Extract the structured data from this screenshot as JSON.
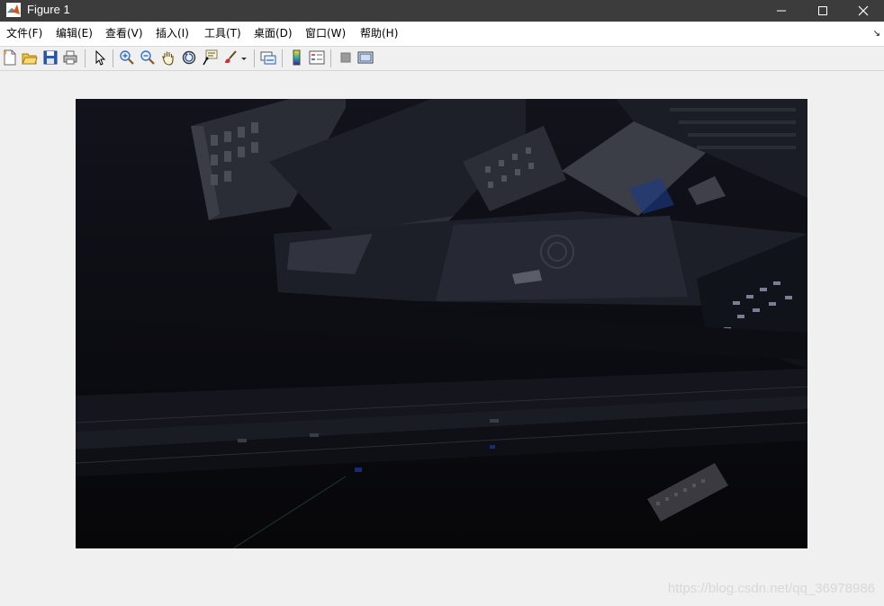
{
  "window": {
    "title": "Figure 1",
    "icon": "matlab-logo-icon",
    "controls": [
      "minimize-icon",
      "maximize-icon",
      "close-icon"
    ]
  },
  "menu": {
    "items": [
      {
        "label": "文件(F)"
      },
      {
        "label": "编辑(E)"
      },
      {
        "label": "查看(V)"
      },
      {
        "label": "插入(I)"
      },
      {
        "label": "工具(T)"
      },
      {
        "label": "桌面(D)"
      },
      {
        "label": "窗口(W)"
      },
      {
        "label": "帮助(H)"
      }
    ],
    "overflow_arrow": "↘"
  },
  "toolbar": {
    "buttons": [
      "new-figure-icon",
      "open-file-icon",
      "save-icon",
      "print-icon",
      "edit-plot-arrow-icon",
      "zoom-in-icon",
      "zoom-out-icon",
      "pan-hand-icon",
      "rotate-3d-icon",
      "data-cursor-icon",
      "brush-icon",
      "link-plot-icon",
      "insert-colorbar-icon",
      "insert-legend-icon",
      "hide-plot-tools-icon",
      "show-plot-tools-icon"
    ]
  },
  "figure": {
    "content": "aerial night image of city buildings and roads"
  },
  "watermark": {
    "text": "https://blog.csdn.net/qq_36978986"
  },
  "colors": {
    "titlebar": "#3c3c3c",
    "menubar": "#ffffff",
    "background": "#f0f0f0",
    "image_dark": "#08080c"
  }
}
